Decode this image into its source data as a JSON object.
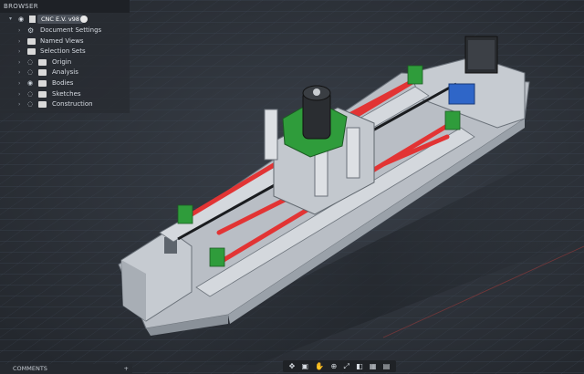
{
  "browser": {
    "title": "BROWSER",
    "root": {
      "label": "CNC E.V. v98"
    },
    "items": [
      {
        "label": "Document Settings",
        "icon": "gear-icon",
        "has_eye": false
      },
      {
        "label": "Named Views",
        "icon": "folder-icon",
        "has_eye": false
      },
      {
        "label": "Selection Sets",
        "icon": "folder-icon",
        "has_eye": false
      },
      {
        "label": "Origin",
        "icon": "folder-icon",
        "has_eye": true
      },
      {
        "label": "Analysis",
        "icon": "folder-icon",
        "has_eye": true
      },
      {
        "label": "Bodies",
        "icon": "folder-icon",
        "has_eye": true
      },
      {
        "label": "Sketches",
        "icon": "folder-icon",
        "has_eye": true
      },
      {
        "label": "Construction",
        "icon": "folder-icon",
        "has_eye": true
      }
    ]
  },
  "comments": {
    "title": "COMMENTS",
    "add": "+"
  },
  "nav_icons": [
    "orbit-icon",
    "look-at-icon",
    "pan-icon",
    "zoom-icon",
    "fit-icon",
    "display-mode-icon",
    "grid-icon",
    "viewports-icon"
  ],
  "colors": {
    "grid": "#3a4350",
    "frame": "#c8cdd3",
    "rail": "#d62c2c",
    "mount": "#2d9a3a",
    "stepper_drive": "#2f66c8"
  }
}
